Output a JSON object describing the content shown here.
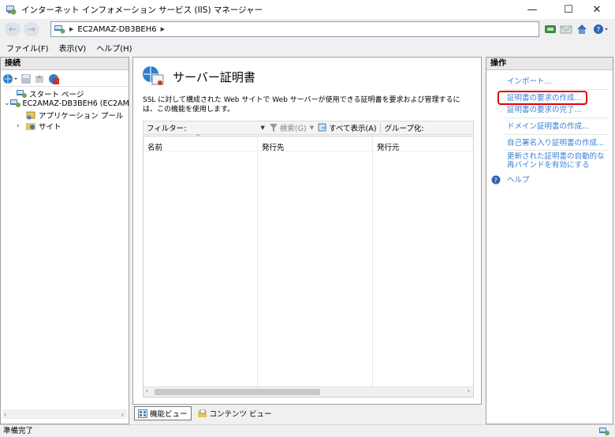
{
  "window": {
    "title": "インターネット インフォメーション サービス (IIS) マネージャー",
    "minimize": "—",
    "maximize": "☐",
    "close": "✕"
  },
  "address": {
    "breadcrumb": [
      "EC2AMAZ-DB3BEH6"
    ],
    "sep": "▶"
  },
  "menu": {
    "file": "ファイル(F)",
    "view": "表示(V)",
    "help": "ヘルプ(H)"
  },
  "connections": {
    "header": "接続",
    "tree": {
      "start_page": "スタート ページ",
      "server": "EC2AMAZ-DB3BEH6 (EC2AMA",
      "app_pools": "アプリケーション プール",
      "sites": "サイト"
    }
  },
  "feature": {
    "title": "サーバー証明書",
    "description": "SSL に対して構成された Web サイトで Web サーバーが使用できる証明書を要求および管理するには、この機能を使用します。",
    "filter_label": "フィルター:",
    "search_label": "検索(G)",
    "show_all_label": "すべて表示(A)",
    "group_label": "グループ化:",
    "columns": [
      "名前",
      "発行先",
      "発行元"
    ]
  },
  "viewtabs": {
    "features": "機能ビュー",
    "content": "コンテンツ ビュー"
  },
  "actions": {
    "header": "操作",
    "items": [
      "インポート...",
      "証明書の要求の作成...",
      "証明書の要求の完了...",
      "ドメイン証明書の作成...",
      "自己署名入り証明書の作成...",
      "更新された証明書の自動的な再バインドを有効にする"
    ],
    "help": "ヘルプ"
  },
  "status": {
    "text": "準備完了"
  },
  "colors": {
    "link": "#3a7fd4",
    "highlight": "#e00000",
    "panel_border": "#a0a0a0"
  }
}
